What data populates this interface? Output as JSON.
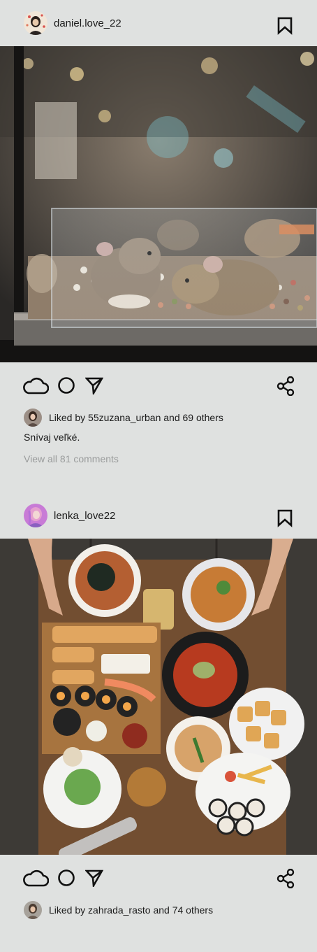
{
  "posts": [
    {
      "username": "daniel.love_22",
      "photo_subject": "Hamsters in a glass pet-shop display",
      "likes_prefix": "Liked by ",
      "likes_user": "55zuzana_urban",
      "likes_suffix": " and 69 others",
      "caption": "Snívaj veľké.",
      "view_comments": "View all 81 comments"
    },
    {
      "username": "lenka_love22",
      "photo_subject": "Table full of sushi and noodle dishes",
      "likes_prefix": "Liked by ",
      "likes_user": "zahrada_rasto",
      "likes_suffix": " and 74 others"
    }
  ],
  "icons": {
    "like": "cloud-icon",
    "comment": "circle-icon",
    "send": "send-arrow-icon",
    "share": "share-icon",
    "bookmark": "bookmark-icon"
  },
  "colors": {
    "background": "#dfe1e0",
    "text": "#1a1a1a",
    "muted": "#9a9c9c"
  }
}
